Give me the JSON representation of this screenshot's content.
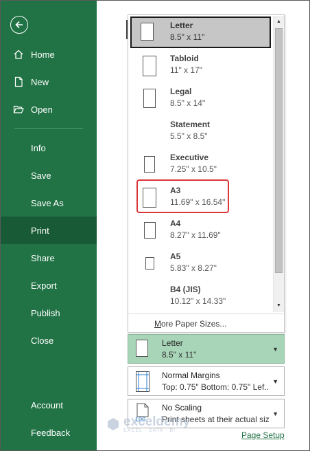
{
  "sidebar": {
    "back_icon": "arrow-left-circle-icon",
    "items": [
      {
        "label": "Home",
        "icon": "home-icon"
      },
      {
        "label": "New",
        "icon": "new-document-icon"
      },
      {
        "label": "Open",
        "icon": "folder-open-icon"
      },
      {
        "label": "Info"
      },
      {
        "label": "Save"
      },
      {
        "label": "Save As"
      },
      {
        "label": "Print",
        "selected": true
      },
      {
        "label": "Share"
      },
      {
        "label": "Export"
      },
      {
        "label": "Publish"
      },
      {
        "label": "Close"
      },
      {
        "label": "Account"
      },
      {
        "label": "Feedback"
      }
    ]
  },
  "paper_sizes": {
    "options": [
      {
        "name": "Letter",
        "dims": "8.5\" x 11\"",
        "selected": true
      },
      {
        "name": "Tabloid",
        "dims": "11\" x 17\""
      },
      {
        "name": "Legal",
        "dims": "8.5\" x 14\""
      },
      {
        "name": "Statement",
        "dims": "5.5\" x 8.5\""
      },
      {
        "name": "Executive",
        "dims": "7.25\" x 10.5\""
      },
      {
        "name": "A3",
        "dims": "11.69\" x 16.54\"",
        "highlighted": true
      },
      {
        "name": "A4",
        "dims": "8.27\" x 11.69\""
      },
      {
        "name": "A5",
        "dims": "5.83\" x 8.27\""
      },
      {
        "name": "B4 (JIS)",
        "dims": "10.12\" x 14.33\""
      }
    ],
    "more_label": "More Paper Sizes...",
    "more_mnemonic": "M",
    "more_rest": "ore Paper Sizes..."
  },
  "settings": {
    "paper": {
      "title": "Letter",
      "detail": "8.5\" x 11\""
    },
    "margins": {
      "title": "Normal Margins",
      "detail": "Top: 0.75\" Bottom: 0.75\" Lef..."
    },
    "scaling": {
      "title": "No Scaling",
      "detail": "Print sheets at their actual size",
      "icon_text": "100"
    }
  },
  "page_setup_link": "Page Setup",
  "watermark": {
    "brand": "exceldemy",
    "tagline": "EXCEL · DATA · BI"
  },
  "colors": {
    "sidebar": "#217346",
    "sidebar_selected": "#195a36",
    "paper_selected": "#a8d5b8",
    "highlight": "#d9383a"
  }
}
